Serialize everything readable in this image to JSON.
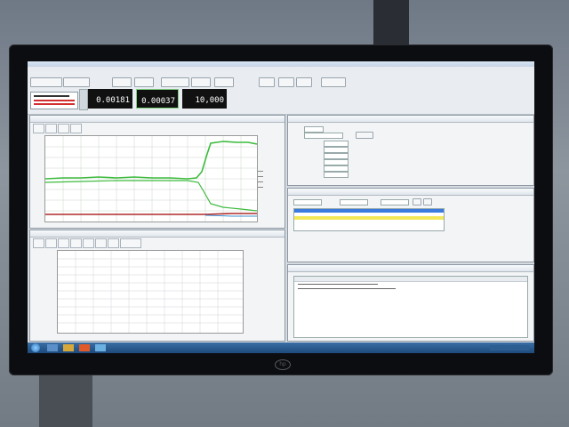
{
  "toolbar": {
    "readouts": [
      {
        "label": "",
        "value": "0.00181"
      },
      {
        "label": "",
        "value": "0.00037"
      },
      {
        "label": "",
        "value": "10,000"
      }
    ]
  },
  "table": {
    "rows": [
      {
        "v1": "",
        "v2": "",
        "v3": "",
        "highlight": "blue"
      },
      {
        "v1": "",
        "v2": "",
        "v3": "",
        "highlight": "none"
      },
      {
        "v1": "",
        "v2": "",
        "v3": "",
        "highlight": "yellow"
      },
      {
        "v1": "",
        "v2": "",
        "v3": "",
        "highlight": "none"
      },
      {
        "v1": "",
        "v2": "",
        "v3": "",
        "highlight": "none"
      }
    ]
  },
  "colors": {
    "green_trace": "#3dbb3d",
    "red_trace": "#b02a2a",
    "grid": "#c9d6c9",
    "selection_blue": "#3b7be0",
    "selection_yellow": "#f3e85a"
  },
  "icons": {
    "taskbar_start": "windows-start-icon",
    "monitor_logo": "hp-logo-icon"
  }
}
